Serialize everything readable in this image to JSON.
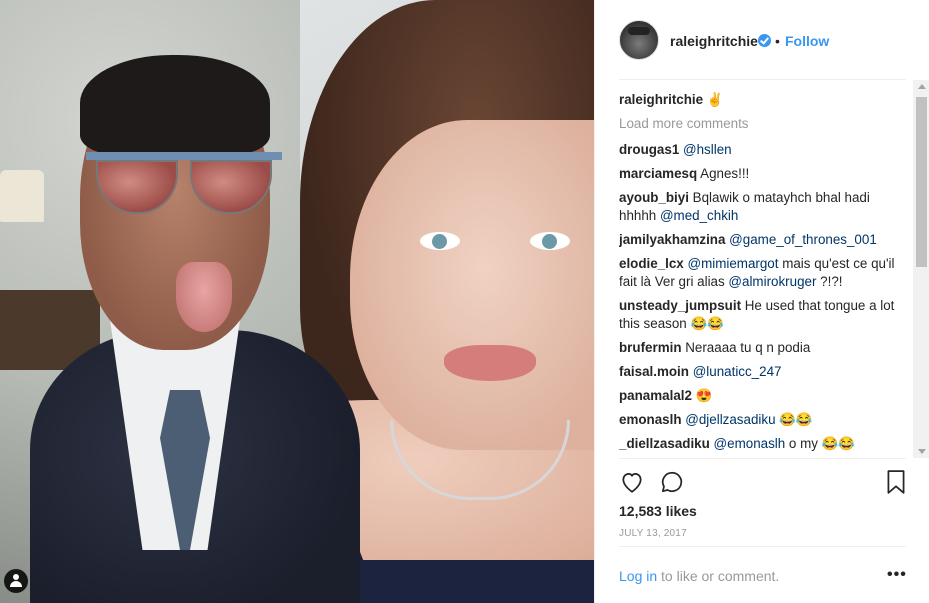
{
  "post": {
    "username": "raleighritchie",
    "dot": "•",
    "follow_label": "Follow",
    "likes": "12,583 likes",
    "date": "JULY 13, 2017",
    "login_link": "Log in",
    "login_rest": " to like or comment.",
    "more_label": "•••"
  },
  "caption": {
    "user": "raleighritchie",
    "text": " ✌"
  },
  "load_more": "Load more comments",
  "comments": [
    {
      "user": "drougas1",
      "mention": "@hsllen",
      "text": ""
    },
    {
      "user": "marciamesq",
      "mention": "",
      "text": " Agnes!!!"
    },
    {
      "user": "ayoub_biyi",
      "mention": "",
      "text": " Bqlawik o matayhch bhal hadi hhhhh ",
      "mention2": "@med_chkih"
    },
    {
      "user": "jamilyakhamzina",
      "mention": "@game_of_thrones_001",
      "text": ""
    },
    {
      "user": "elodie_lcx",
      "mention": "@mimiemargot",
      "text": " mais qu'est ce qu'il fait là Ver gri alias ",
      "mention2": "@almirokruger",
      "text2": " ?!?!"
    },
    {
      "user": "unsteady_jumpsuit",
      "mention": "",
      "text": " He used that tongue a lot this season 😂😂"
    },
    {
      "user": "brufermin",
      "mention": "",
      "text": " Neraaaa tu q n podia"
    },
    {
      "user": "faisal.moin",
      "mention": "@lunaticc_247",
      "text": ""
    },
    {
      "user": "panamalal2",
      "mention": "",
      "text": " 😍"
    },
    {
      "user": "emonaslh",
      "mention": "@djellzasadiku",
      "text": " 😂😂"
    },
    {
      "user": "_diellzasadiku",
      "mention": "@emonaslh",
      "text": " o my 😂😂"
    }
  ],
  "icons": {
    "heart": "heart-icon",
    "comment": "comment-icon",
    "bookmark": "bookmark-icon",
    "tag": "user-tag-icon",
    "verified": "verified-badge-icon"
  },
  "colors": {
    "link": "#3897f0",
    "mention": "#003569",
    "muted": "#999999",
    "text": "#262626"
  }
}
